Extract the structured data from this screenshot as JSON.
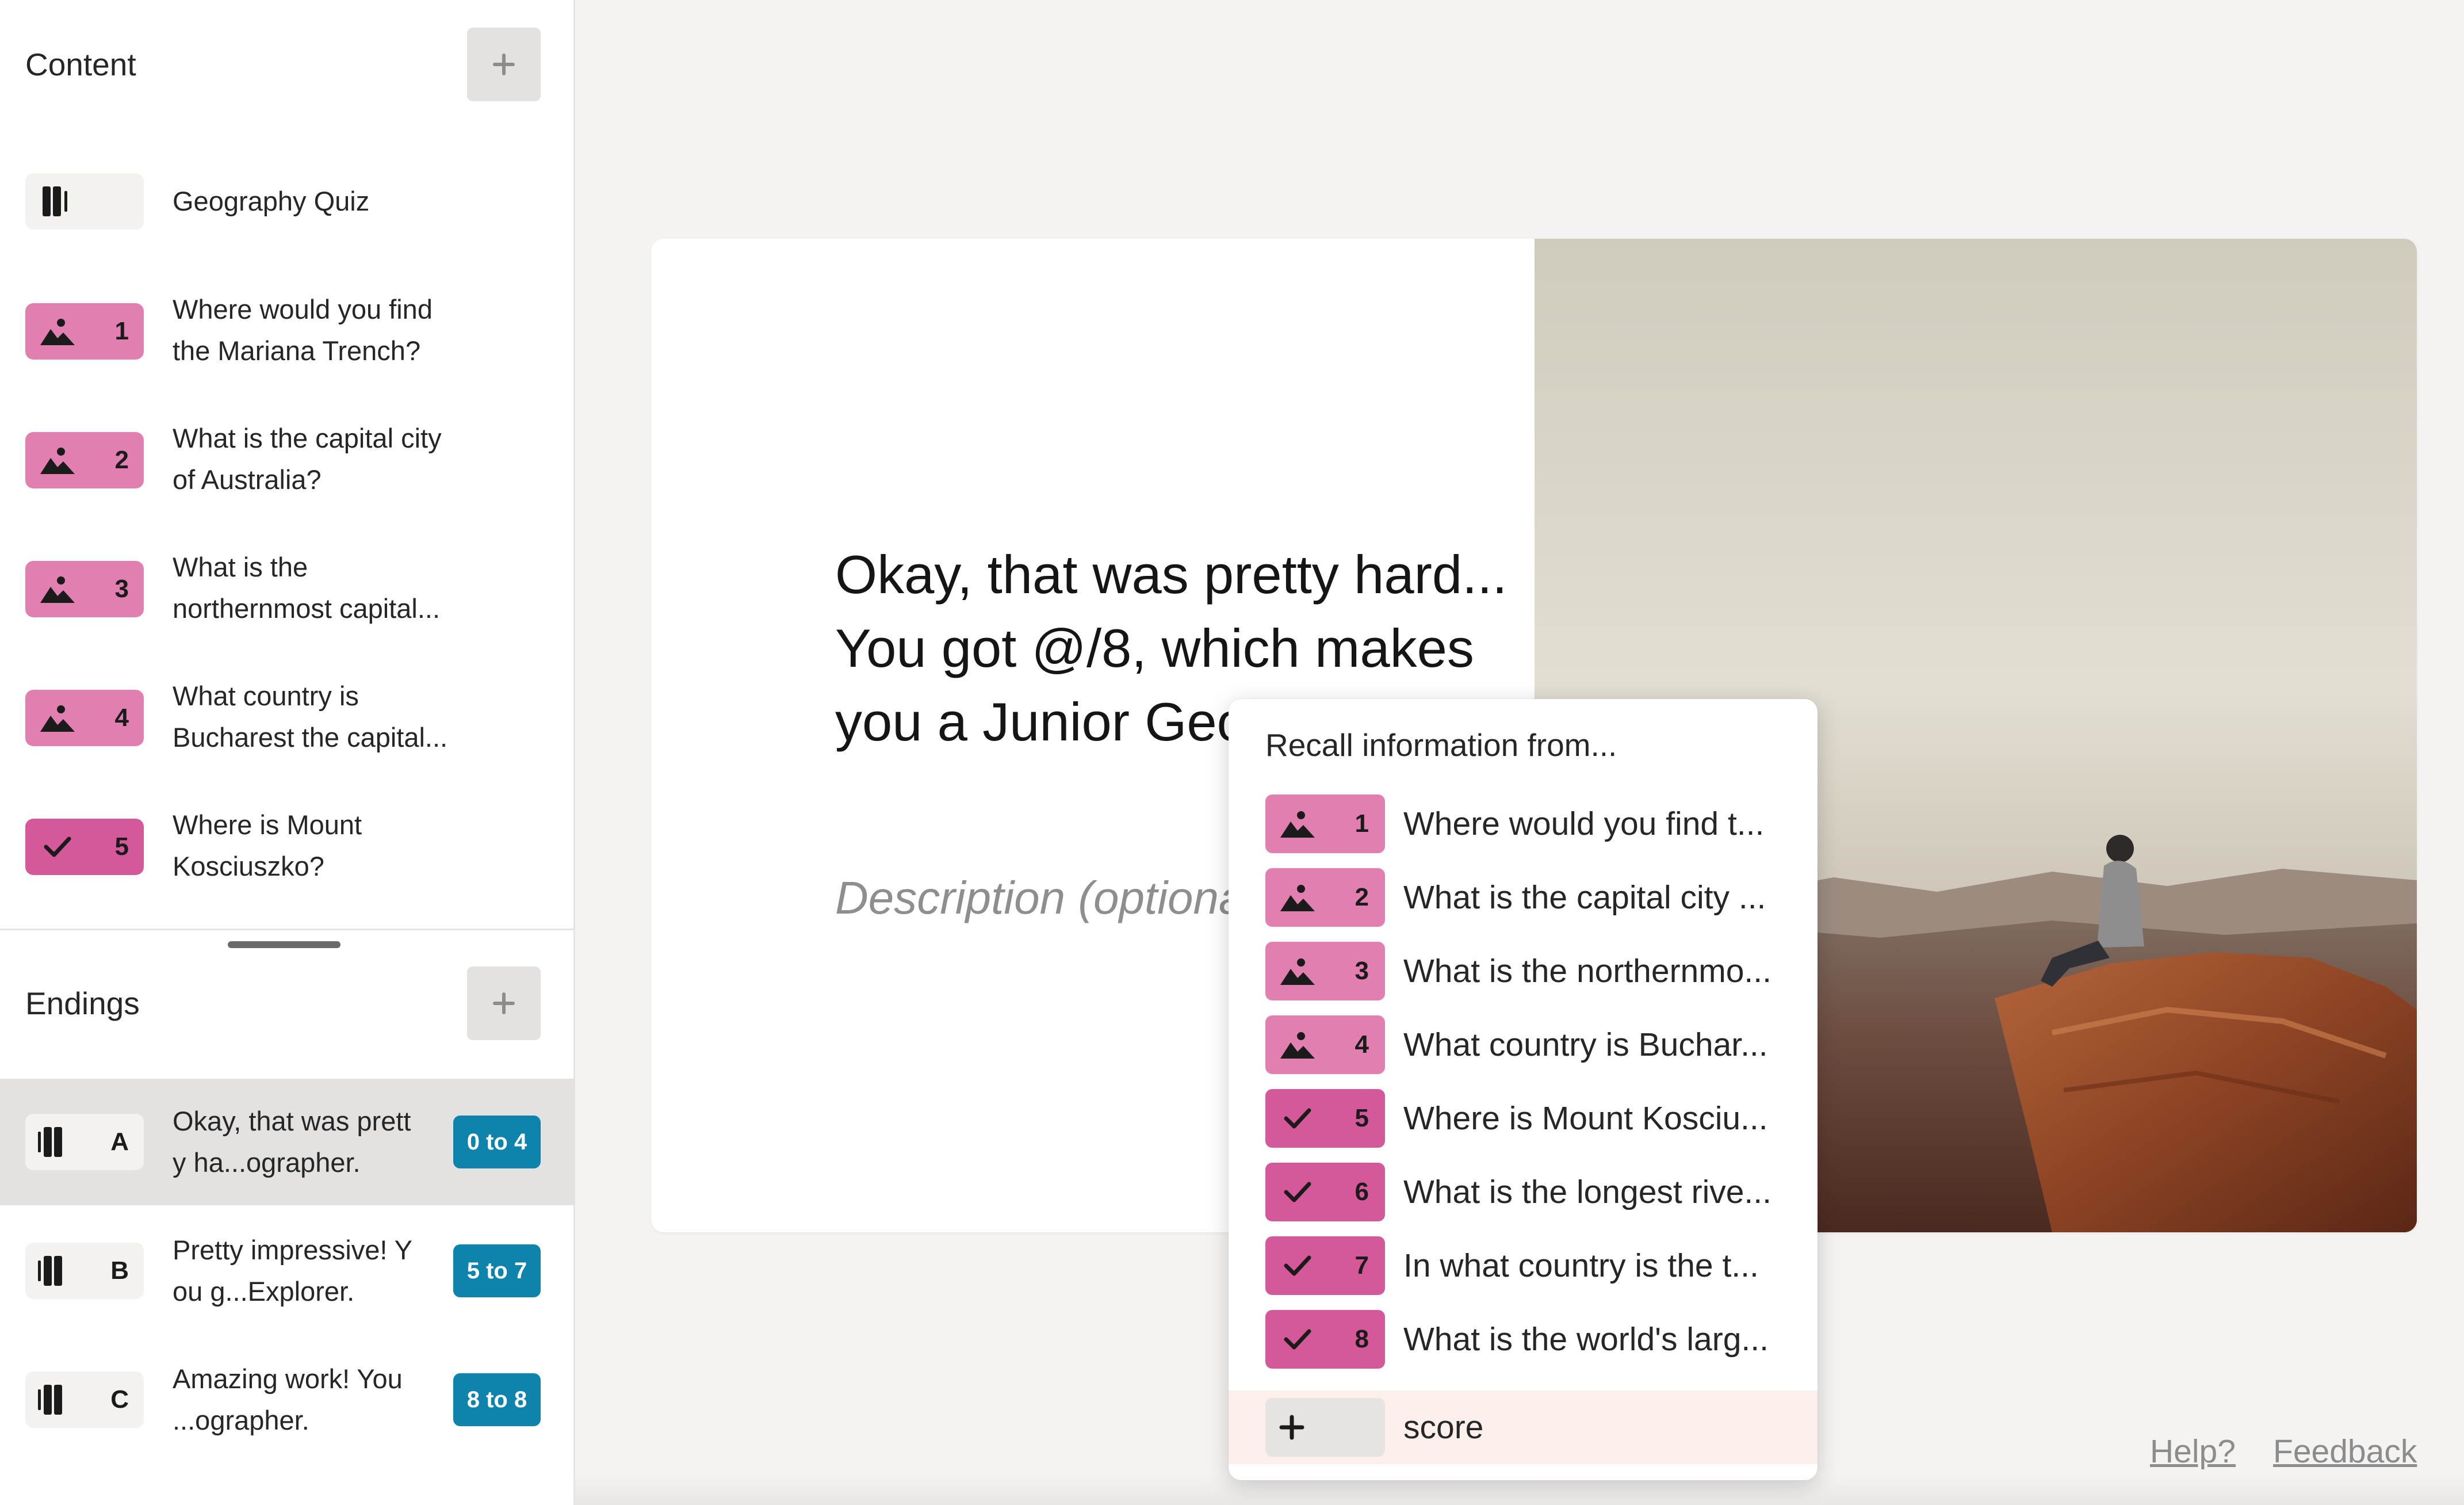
{
  "sidebar": {
    "content_title": "Content",
    "endings_title": "Endings",
    "welcome": {
      "label": "Geography Quiz",
      "icon": "statement-icon"
    },
    "questions": [
      {
        "number": "1",
        "line1": "Where would you find",
        "line2": "the Mariana Trench?",
        "icon": "picture-choice-icon"
      },
      {
        "number": "2",
        "line1": "What is the capital city",
        "line2": "of Australia?",
        "icon": "picture-choice-icon"
      },
      {
        "number": "3",
        "line1": "What is the",
        "line2": "northernmost capital...",
        "icon": "picture-choice-icon"
      },
      {
        "number": "4",
        "line1": "What country is",
        "line2": "Bucharest the capital...",
        "icon": "picture-choice-icon"
      },
      {
        "number": "5",
        "line1": "Where is Mount",
        "line2": "Kosciuszko?",
        "icon": "checkmark-icon"
      }
    ],
    "endings": [
      {
        "letter": "A",
        "line1": "Okay, that was prett",
        "line2": "y ha...ographer.",
        "range": "0 to 4"
      },
      {
        "letter": "B",
        "line1": "Pretty impressive! Y",
        "line2": "ou g...Explorer.",
        "range": "5 to 7"
      },
      {
        "letter": "C",
        "line1": "Amazing work! You",
        "line2": "...ographer.",
        "range": "8 to 8"
      }
    ]
  },
  "preview": {
    "title": "Okay, that was pretty hard... You got @/8, which makes you a Junior Geographer.",
    "description_placeholder": "Description (optional)"
  },
  "recall": {
    "title": "Recall information from...",
    "items": [
      {
        "number": "1",
        "label": "Where would you find t...",
        "icon": "picture-choice-icon"
      },
      {
        "number": "2",
        "label": "What is the capital city ...",
        "icon": "picture-choice-icon"
      },
      {
        "number": "3",
        "label": "What is the northernmo...",
        "icon": "picture-choice-icon"
      },
      {
        "number": "4",
        "label": "What country is Buchar...",
        "icon": "picture-choice-icon"
      },
      {
        "number": "5",
        "label": "Where is Mount Kosciu...",
        "icon": "checkmark-icon"
      },
      {
        "number": "6",
        "label": "What is the longest rive...",
        "icon": "checkmark-icon"
      },
      {
        "number": "7",
        "label": "In what country is the t...",
        "icon": "checkmark-icon"
      },
      {
        "number": "8",
        "label": "What is the world's larg...",
        "icon": "checkmark-icon"
      }
    ],
    "score": {
      "label": "score",
      "icon": "plus-icon"
    }
  },
  "footer": {
    "help": "Help?",
    "feedback": "Feedback"
  },
  "colors": {
    "picture_choice": "#e17fb0",
    "yes_no": "#d5589a",
    "range_badge": "#0e84ad",
    "selected_row": "#e3e2e1"
  }
}
